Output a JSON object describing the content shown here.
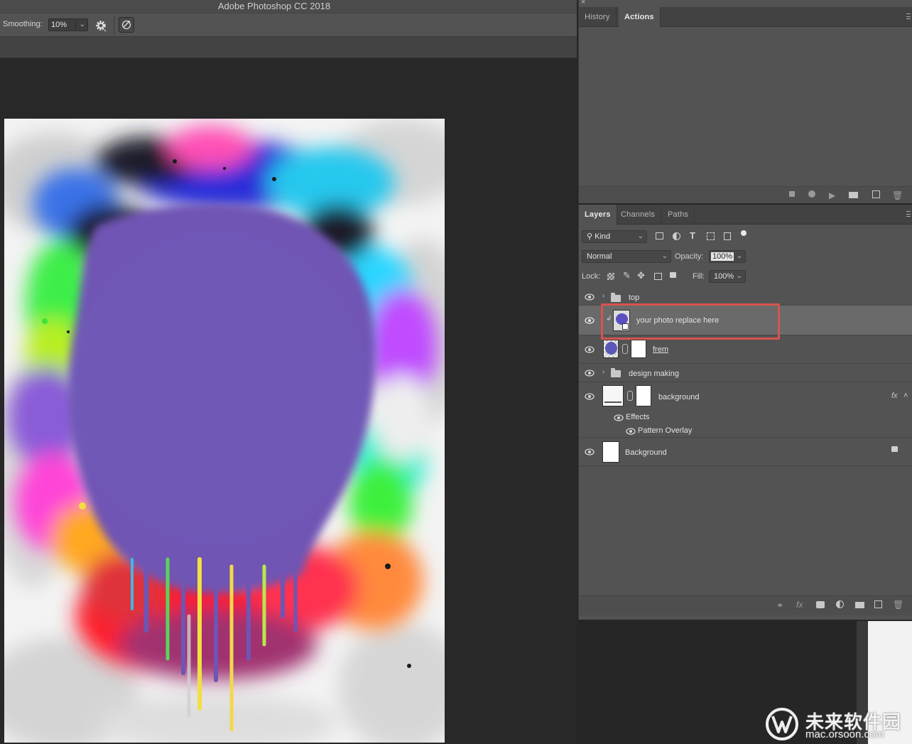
{
  "app": {
    "title": "Adobe Photoshop CC 2018"
  },
  "options_bar": {
    "smoothing_label": "Smoothing:",
    "smoothing_value": "10%"
  },
  "top_panel": {
    "tabs": [
      {
        "label": "History",
        "active": false
      },
      {
        "label": "Actions",
        "active": true
      }
    ]
  },
  "layers_panel": {
    "tabs": [
      {
        "label": "Layers",
        "active": true
      },
      {
        "label": "Channels",
        "active": false
      },
      {
        "label": "Paths",
        "active": false
      }
    ],
    "filter_kind": "Kind",
    "blend_mode": "Normal",
    "opacity_label": "Opacity:",
    "opacity_value": "100%",
    "lock_label": "Lock:",
    "fill_label": "Fill:",
    "fill_value": "100%",
    "layers": {
      "top": "top",
      "photo": "your photo replace here",
      "frem": "frem",
      "design": "design making",
      "background_fx": "background",
      "effects": "Effects",
      "pattern_overlay": "Pattern Overlay",
      "background": "Background"
    },
    "fx_badge": "fx"
  },
  "watermark": {
    "cn": "未来软件园",
    "url": "mac.orsoon.com"
  },
  "colors": {
    "accent_highlight": "#d9534f",
    "paint_purple": "#6f55b4",
    "panel_bg": "#535353"
  }
}
